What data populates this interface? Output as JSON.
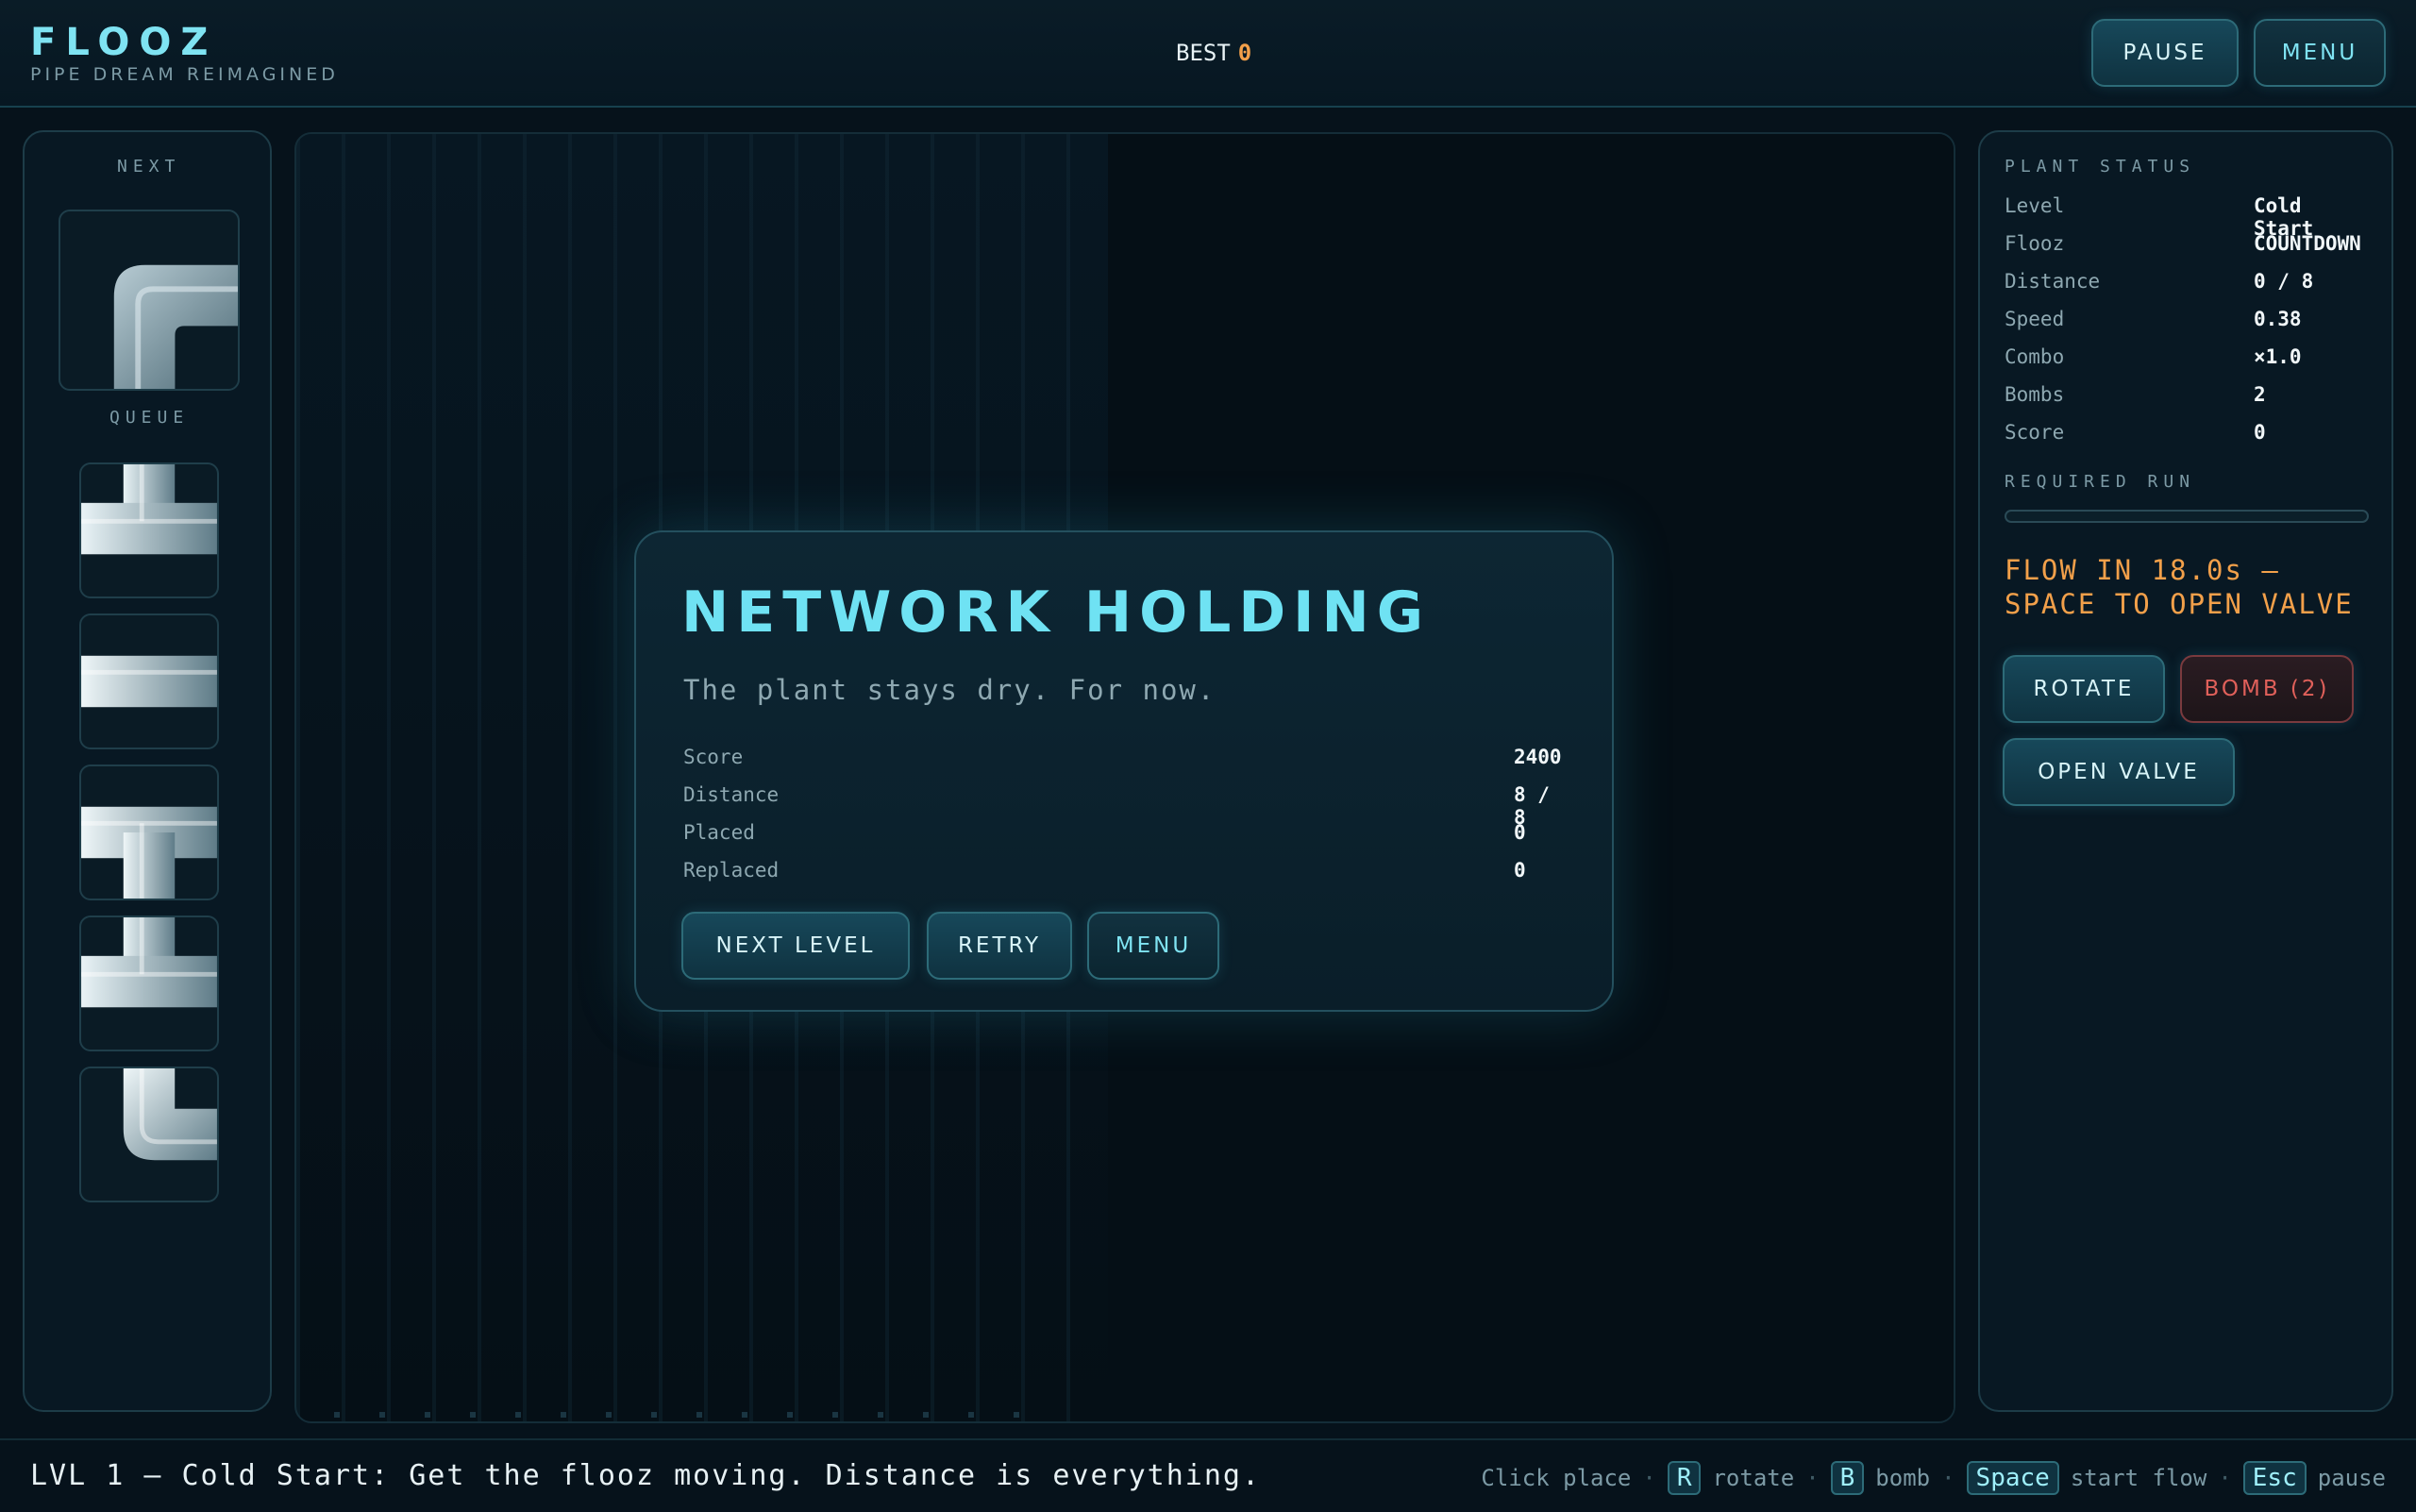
{
  "brand": {
    "title": "FLOOZ",
    "subtitle": "PIPE DREAM REIMAGINED"
  },
  "header": {
    "best_label": "BEST",
    "best_value": "0",
    "pause_label": "PAUSE",
    "menu_label": "MENU"
  },
  "left_panel": {
    "next_label": "NEXT",
    "queue_label": "QUEUE",
    "next_piece": "corner-bottom-right",
    "queue": [
      "tee-up",
      "straight-horizontal",
      "tee-down",
      "tee-up",
      "corner-up-right"
    ]
  },
  "modal": {
    "title": "NETWORK HOLDING",
    "subtitle": "The plant stays dry. For now.",
    "stats": [
      {
        "label": "Score",
        "value": "2400"
      },
      {
        "label": "Distance",
        "value": "8 / 8"
      },
      {
        "label": "Placed",
        "value": "0"
      },
      {
        "label": "Replaced",
        "value": "0"
      }
    ],
    "next_level_label": "NEXT LEVEL",
    "retry_label": "RETRY",
    "menu_label": "MENU"
  },
  "status": {
    "heading": "PLANT STATUS",
    "rows": [
      {
        "label": "Level",
        "value": "Cold Start"
      },
      {
        "label": "Flooz",
        "value": "COUNTDOWN"
      },
      {
        "label": "Distance",
        "value": "0 / 8"
      },
      {
        "label": "Speed",
        "value": "0.38"
      },
      {
        "label": "Combo",
        "value": "×1.0"
      },
      {
        "label": "Bombs",
        "value": "2"
      },
      {
        "label": "Score",
        "value": "0"
      }
    ],
    "required_run_label": "REQUIRED RUN",
    "required_run_progress": 0,
    "countdown_text": "FLOW IN 18.0s — SPACE TO OPEN VALVE",
    "rotate_label": "ROTATE",
    "bomb_label": "BOMB (2)",
    "open_valve_label": "OPEN VALVE"
  },
  "footer": {
    "message": "LVL 1 — Cold Start: Get the flooz moving. Distance is everything.",
    "hints": {
      "click_text": "Click place",
      "rotate_key": "R",
      "rotate_text": "rotate",
      "bomb_key": "B",
      "bomb_text": "bomb",
      "space_key": "Space",
      "space_text": "start flow",
      "esc_key": "Esc",
      "esc_text": "pause"
    }
  },
  "colors": {
    "accent": "#6fe2f3",
    "warning": "#f2a04a",
    "danger": "#e0605a",
    "background": "#06121b"
  }
}
